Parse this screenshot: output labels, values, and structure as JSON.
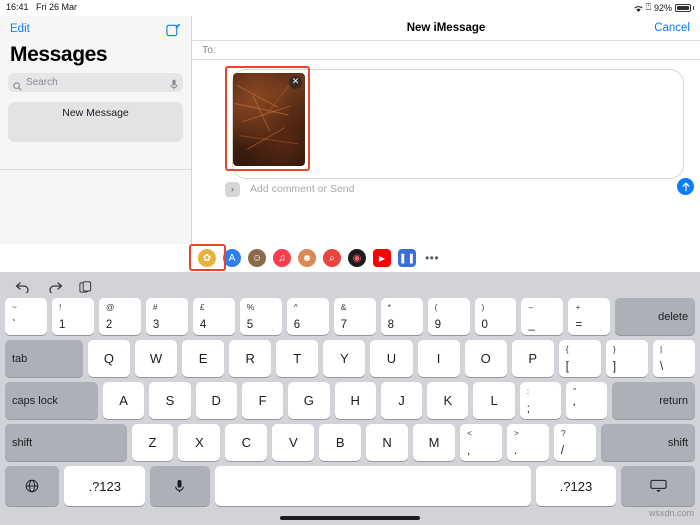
{
  "status_bar": {
    "time": "16:41",
    "date": "Fri 26 Mar",
    "battery_text": "92%",
    "wifi_icon": "wifi-icon",
    "battery_icon": "battery-icon",
    "bluetooth_icon": "headphones-icon"
  },
  "sidebar": {
    "edit_label": "Edit",
    "compose_icon": "compose-icon",
    "title": "Messages",
    "search": {
      "placeholder": "Search",
      "search_icon": "search-icon",
      "mic_icon": "microphone-icon"
    },
    "conversations": [
      {
        "title": "New Message"
      }
    ]
  },
  "compose": {
    "title": "New iMessage",
    "cancel_label": "Cancel",
    "to_label": "To:",
    "to_value": "",
    "attachment": {
      "close_icon": "remove-attachment-icon",
      "alt": "pine-needles-photo"
    },
    "expand_icon": "›",
    "input_placeholder": "Add comment or Send",
    "send_icon": "send-arrow-icon"
  },
  "app_drawer": {
    "items": [
      {
        "name": "photos-app",
        "glyph": "✿",
        "color": "#e8b33a"
      },
      {
        "name": "app-store-app",
        "glyph": "A",
        "color": "#2d7ff0"
      },
      {
        "name": "memoji-app",
        "glyph": "☺",
        "color": "#8a6a4b"
      },
      {
        "name": "music-app",
        "glyph": "♫",
        "color": "#fa3c4c"
      },
      {
        "name": "animoji-app",
        "glyph": "☻",
        "color": "#d98a50"
      },
      {
        "name": "images-search-app",
        "glyph": "⌕",
        "color": "#e8453c"
      },
      {
        "name": "podcast-app",
        "glyph": "◉",
        "color": "#1c1c1e"
      },
      {
        "name": "youtube-app",
        "glyph": "▶",
        "color": "#ff0000"
      },
      {
        "name": "mediaplayer-app",
        "glyph": "▌▐",
        "color": "#3b6fd6"
      },
      {
        "name": "more-apps",
        "glyph": "•••",
        "color": "#ffffff"
      }
    ]
  },
  "keyboard": {
    "toolbar": {
      "undo_icon": "undo-icon",
      "redo_icon": "redo-icon",
      "paste_icon": "paste-icon"
    },
    "rows": {
      "numbers": [
        {
          "sup": "~",
          "sub": "`"
        },
        {
          "sup": "!",
          "sub": "1"
        },
        {
          "sup": "@",
          "sub": "2"
        },
        {
          "sup": "#",
          "sub": "3"
        },
        {
          "sup": "£",
          "sub": "4"
        },
        {
          "sup": "%",
          "sub": "5"
        },
        {
          "sup": "^",
          "sub": "6"
        },
        {
          "sup": "&",
          "sub": "7"
        },
        {
          "sup": "*",
          "sub": "8"
        },
        {
          "sup": "(",
          "sub": "9"
        },
        {
          "sup": ")",
          "sub": "0"
        },
        {
          "sup": "–",
          "sub": "_"
        },
        {
          "sup": "+",
          "sub": "="
        }
      ],
      "delete_label": "delete",
      "top": {
        "tab_label": "tab",
        "keys": [
          "Q",
          "W",
          "E",
          "R",
          "T",
          "Y",
          "U",
          "I",
          "O",
          "P"
        ],
        "bracket_open": {
          "sup": "{",
          "sub": "["
        },
        "bracket_close": {
          "sup": "}",
          "sub": "]"
        },
        "pipe": {
          "sup": "|",
          "sub": "\\"
        }
      },
      "home": {
        "capslock_label": "caps lock",
        "keys": [
          "A",
          "S",
          "D",
          "F",
          "G",
          "H",
          "J",
          "K",
          "L"
        ],
        "semicolon": {
          "sup": ":",
          "sub": ";"
        },
        "quote": {
          "sup": "\"",
          "sub": "'"
        },
        "return_label": "return"
      },
      "bottom": {
        "shift_left_label": "shift",
        "keys": [
          "Z",
          "X",
          "C",
          "V",
          "B",
          "N",
          "M"
        ],
        "comma": {
          "sup": "<",
          "sub": ","
        },
        "period": {
          "sup": ">",
          "sub": "."
        },
        "slash": {
          "sup": "?",
          "sub": "/"
        },
        "shift_right_label": "shift"
      },
      "space": {
        "globe_icon": "globe-icon",
        "num_left_label": ".?123",
        "mic_icon": "microphone-icon",
        "space_label": "",
        "num_right_label": ".?123",
        "emoji_keyboard_icon": "hide-keyboard-icon"
      }
    }
  },
  "watermark": "wsxdn.com",
  "colors": {
    "accent_blue": "#0a7cff",
    "highlight_red": "#e8452c",
    "keyboard_bg": "#d2d3d8",
    "key_dark": "#aeb0b7"
  }
}
